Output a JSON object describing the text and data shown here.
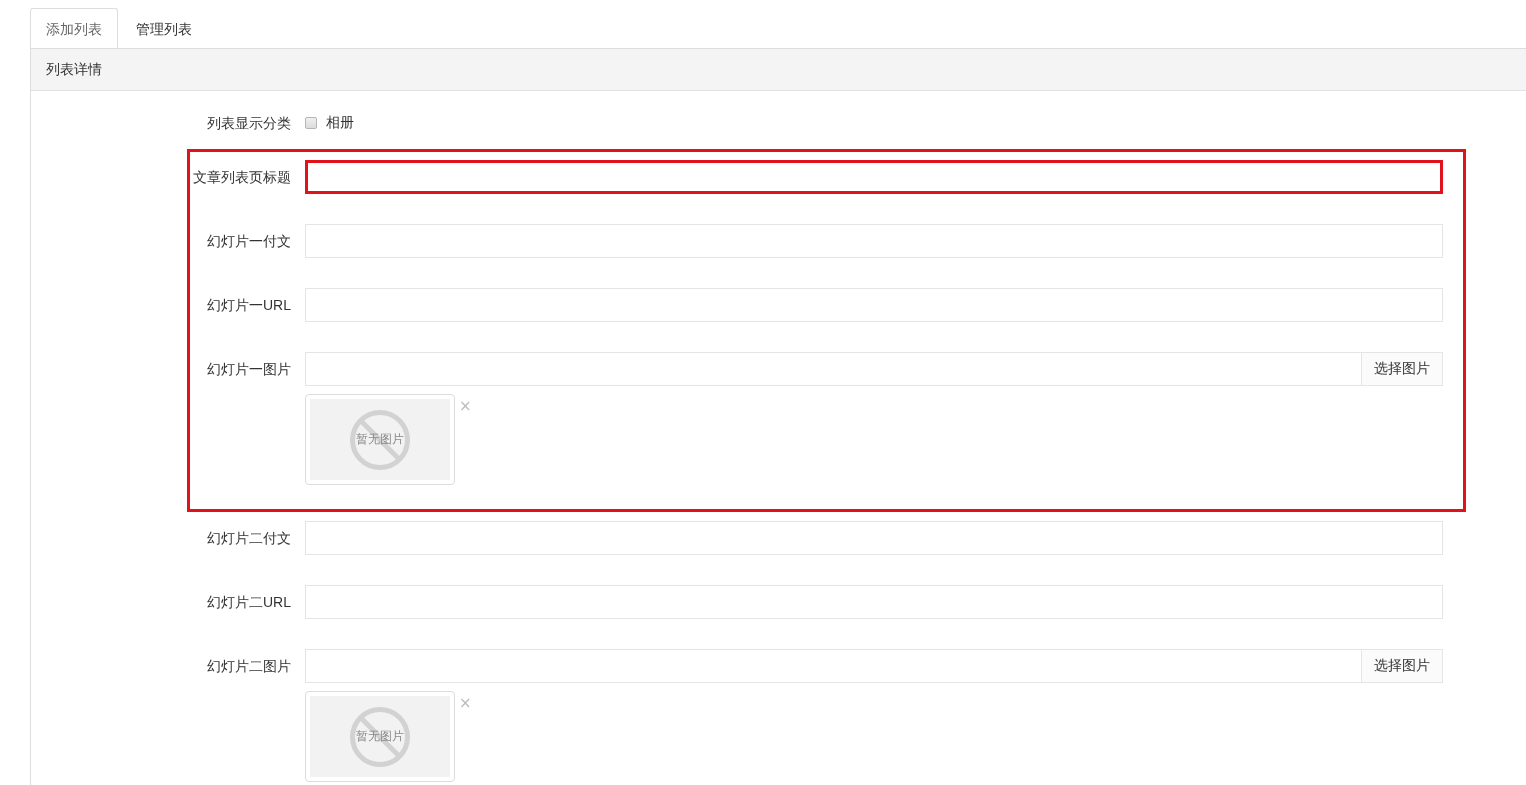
{
  "tabs": [
    {
      "label": "添加列表",
      "selected": true
    },
    {
      "label": "管理列表",
      "selected": false
    }
  ],
  "panel": {
    "title": "列表详情",
    "sections": [
      {
        "framed": false,
        "fields": [
          {
            "kind": "checkboxes",
            "label": "列表显示分类",
            "highlighted": false,
            "options": [
              {
                "label": "相册",
                "checked": false
              }
            ]
          }
        ]
      },
      {
        "framed": true,
        "fields": [
          {
            "kind": "text",
            "label": "文章列表页标题",
            "highlighted": true
          },
          {
            "kind": "text",
            "label": "幻灯片一付文",
            "highlighted": false
          },
          {
            "kind": "text",
            "label": "幻灯片一URL",
            "highlighted": false
          },
          {
            "kind": "image",
            "label": "幻灯片一图片",
            "highlighted": false,
            "button": "选择图片",
            "preview": {
              "placeholder_text": "暂无图片",
              "remove": "×"
            }
          }
        ]
      },
      {
        "framed": false,
        "fields": [
          {
            "kind": "text",
            "label": "幻灯片二付文",
            "highlighted": false
          },
          {
            "kind": "text",
            "label": "幻灯片二URL",
            "highlighted": false
          },
          {
            "kind": "image",
            "label": "幻灯片二图片",
            "highlighted": false,
            "button": "选择图片",
            "preview": {
              "placeholder_text": "暂无图片",
              "remove": "×"
            }
          }
        ]
      }
    ]
  }
}
